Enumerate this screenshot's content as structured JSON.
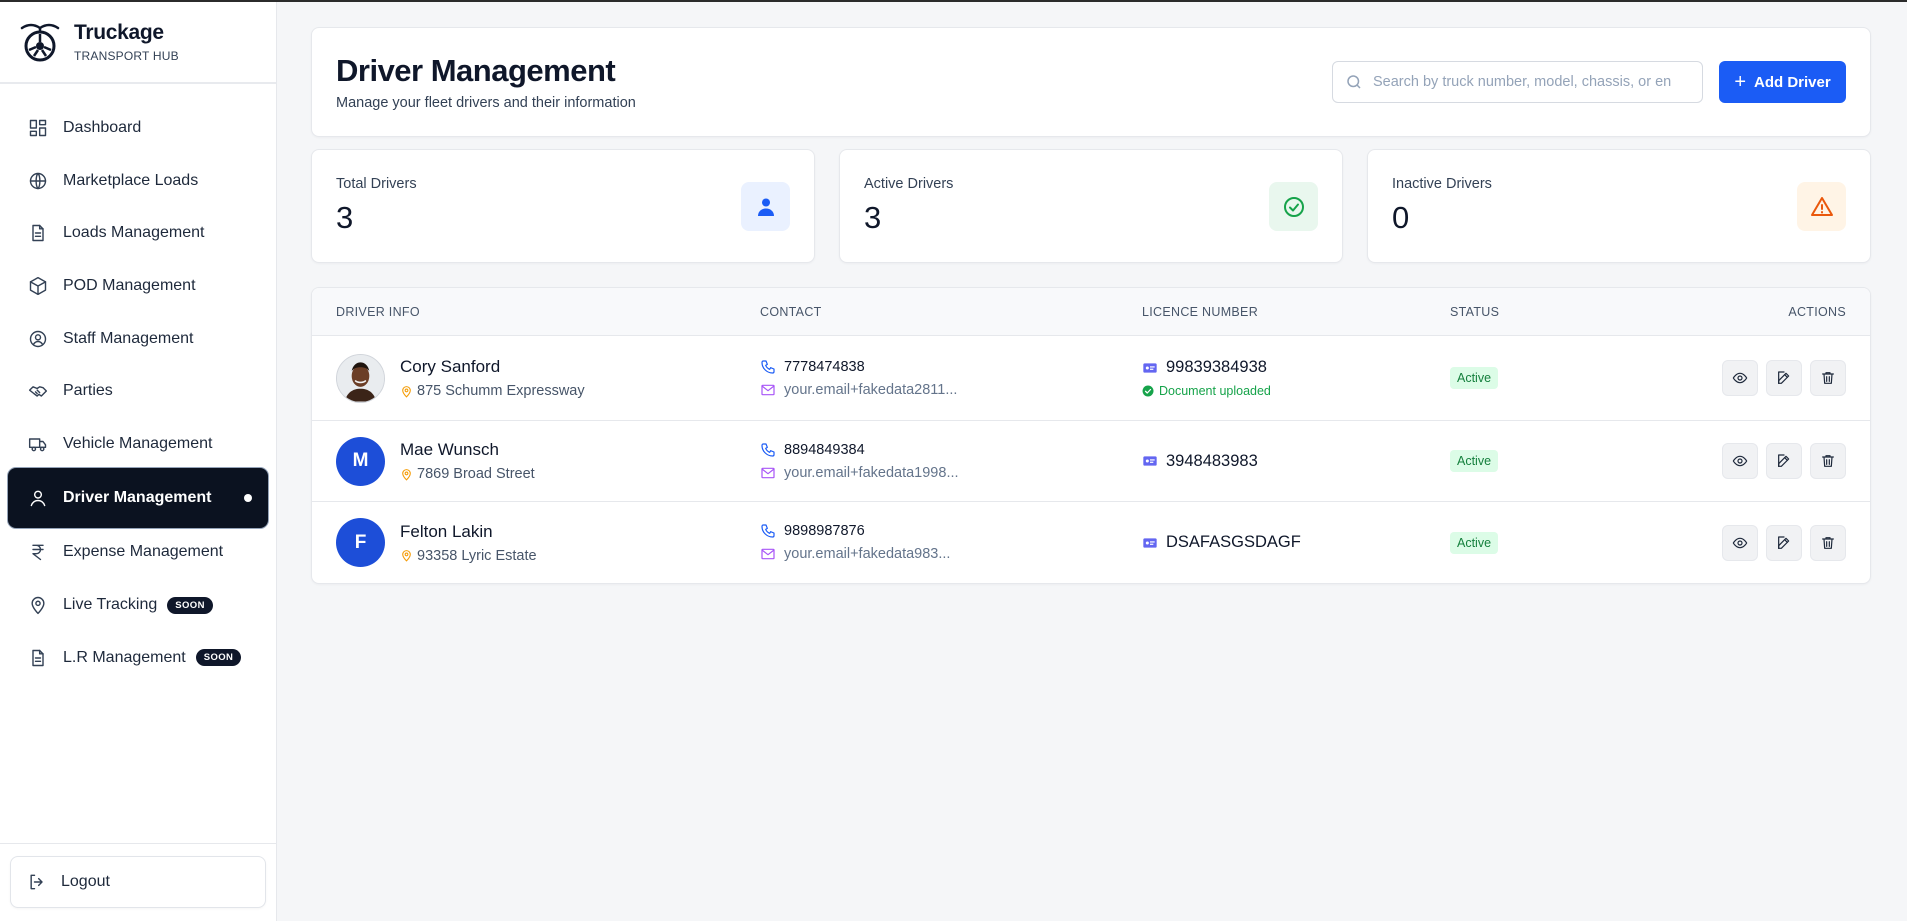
{
  "brand": {
    "title": "Truckage",
    "subtitle": "TRANSPORT HUB"
  },
  "sidebar": {
    "items": [
      {
        "label": "Dashboard",
        "icon": "dashboard-icon"
      },
      {
        "label": "Marketplace Loads",
        "icon": "globe-icon"
      },
      {
        "label": "Loads Management",
        "icon": "document-icon"
      },
      {
        "label": "POD Management",
        "icon": "box-icon"
      },
      {
        "label": "Staff Management",
        "icon": "user-circle-icon"
      },
      {
        "label": "Parties",
        "icon": "handshake-icon"
      },
      {
        "label": "Vehicle Management",
        "icon": "truck-icon"
      },
      {
        "label": "Driver Management",
        "icon": "user-icon",
        "active": true
      },
      {
        "label": "Expense Management",
        "icon": "rupee-icon"
      },
      {
        "label": "Live Tracking",
        "icon": "map-pin-icon",
        "badge": "SOON"
      },
      {
        "label": "L.R Management",
        "icon": "document-icon",
        "badge": "SOON"
      }
    ],
    "logout_label": "Logout"
  },
  "header": {
    "title": "Driver Management",
    "subtitle": "Manage your fleet drivers and their information",
    "search_placeholder": "Search by truck number, model, chassis, or en",
    "add_button_label": "Add Driver"
  },
  "stats": [
    {
      "label": "Total Drivers",
      "value": "3",
      "icon": "user-icon",
      "accent": "#1b5cf5",
      "bg": "#eaf1ff"
    },
    {
      "label": "Active Drivers",
      "value": "3",
      "icon": "check-circle-icon",
      "accent": "#16a34a",
      "bg": "#e9f7ee"
    },
    {
      "label": "Inactive Drivers",
      "value": "0",
      "icon": "warning-icon",
      "accent": "#ea580c",
      "bg": "#fff4e6"
    }
  ],
  "table": {
    "columns": [
      "DRIVER INFO",
      "CONTACT",
      "LICENCE NUMBER",
      "STATUS",
      "ACTIONS"
    ],
    "rows": [
      {
        "name": "Cory Sanford",
        "address": "875 Schumm Expressway",
        "avatar_initial": "",
        "phone": "7778474838",
        "email": "your.email+fakedata2811...",
        "licence": "99839384938",
        "doc_status": "Document uploaded",
        "status": "Active"
      },
      {
        "name": "Mae Wunsch",
        "address": "7869 Broad Street",
        "avatar_initial": "M",
        "phone": "8894849384",
        "email": "your.email+fakedata1998...",
        "licence": "3948483983",
        "doc_status": "",
        "status": "Active"
      },
      {
        "name": "Felton Lakin",
        "address": "93358 Lyric Estate",
        "avatar_initial": "F",
        "phone": "9898987876",
        "email": "your.email+fakedata983...",
        "licence": "DSAFASGSDAGF",
        "doc_status": "",
        "status": "Active"
      }
    ]
  },
  "colors": {
    "primary": "#1b5cf5",
    "sidebar_active": "#0b1220",
    "active_badge_bg": "#dcfce7",
    "active_badge_text": "#15803d"
  }
}
